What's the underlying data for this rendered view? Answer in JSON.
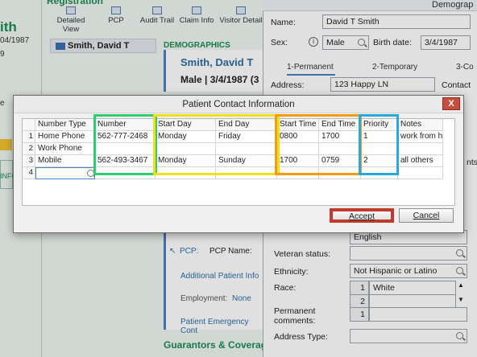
{
  "left": {
    "name": "ith",
    "dob": "04/1987",
    "nine": "9",
    "e": "e",
    "inf": "INFO"
  },
  "registration": {
    "title": "Registration"
  },
  "toolbar": {
    "items": [
      {
        "label": "Detailed View",
        "icon": "detailed-view-icon"
      },
      {
        "label": "PCP",
        "icon": "pcp-icon"
      },
      {
        "label": "Audit Trail",
        "icon": "audit-trail-icon"
      },
      {
        "label": "Claim Info",
        "icon": "claim-info-icon"
      },
      {
        "label": "Visitor Detail",
        "icon": "visitor-detail-icon"
      }
    ]
  },
  "patient_list": {
    "selected": "Smith, David T"
  },
  "demographics": {
    "header": "DEMOGRAPHICS",
    "name": "Smith, David T",
    "summary": "Male | 3/4/1987 (3",
    "pcp_label": "PCP:",
    "pcp_name_label": "PCP Name:",
    "additional_info": "Additional Patient Info",
    "employment_label": "Employment:",
    "employment_value": "None",
    "emergency_contact": "Patient Emergency Cont",
    "guarantors": "Guarantors & Coverag"
  },
  "form": {
    "title": "Demograp",
    "name_label": "Name:",
    "name_value": "David T Smith",
    "sex_label": "Sex:",
    "sex_value": "Male",
    "birth_label": "Birth date:",
    "birth_value": "3/4/1987",
    "tabs": [
      "1-Permanent",
      "2-Temporary",
      "3-Co"
    ],
    "address_label": "Address:",
    "address_value": "123 Happy LN",
    "contact_label": "Contact",
    "language_value": "English",
    "veteran_label": "Veteran status:",
    "ethnicity_label": "Ethnicity:",
    "ethnicity_value": "Not Hispanic or Latino",
    "race_label": "Race:",
    "race_row": "1",
    "race_value": "White",
    "race_row2": "2",
    "perm_comments_label": "Permanent\ncomments:",
    "perm_row": "1",
    "address_type_label": "Address Type:",
    "nts_fragment": "nts"
  },
  "dialog": {
    "title": "Patient Contact Information",
    "close": "X",
    "columns": [
      "Number Type",
      "Number",
      "Start Day",
      "End Day",
      "Start Time",
      "End Time",
      "Priority",
      "Notes"
    ],
    "rows": [
      {
        "n": "1",
        "cells": [
          "Home Phone",
          "562-777-2468",
          "Monday",
          "Friday",
          "0800",
          "1700",
          "1",
          "work from h"
        ]
      },
      {
        "n": "2",
        "cells": [
          "Work Phone",
          "",
          "",
          "",
          "",
          "",
          "",
          ""
        ]
      },
      {
        "n": "3",
        "cells": [
          "Mobile",
          "562-493-3467",
          "Monday",
          "Sunday",
          "1700",
          "0759",
          "2",
          "all others"
        ]
      },
      {
        "n": "4",
        "cells": [
          "",
          "",
          "",
          "",
          "",
          "",
          "",
          ""
        ]
      }
    ],
    "accept": "Accept",
    "cancel": "Cancel"
  },
  "colors": {
    "highlight_green": "#2ecc71",
    "highlight_yellow": "#f4e01a",
    "highlight_orange": "#f39c12",
    "highlight_blue": "#29a8e0",
    "highlight_red": "#c0392b",
    "brand_green": "#1c8a56"
  }
}
